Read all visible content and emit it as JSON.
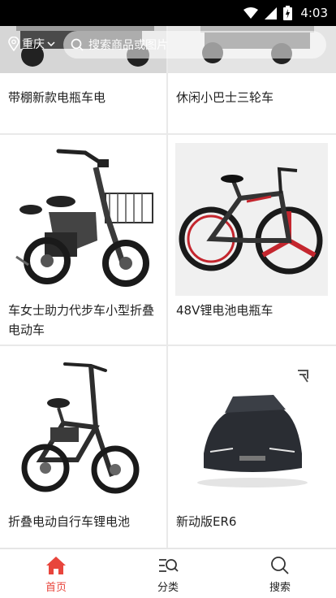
{
  "status_bar": {
    "time": "4:03"
  },
  "header": {
    "location": "重庆",
    "search_placeholder": "搜索商品或图片"
  },
  "products": [
    {
      "name": "带棚新款电瓶车电"
    },
    {
      "name": "休闲小巴士三轮车"
    },
    {
      "name": "车女士助力代步车小型折叠电动车"
    },
    {
      "name": "48V锂电池电瓶车"
    },
    {
      "name": "折叠电动自行车锂电池"
    },
    {
      "name": "新动版ER6"
    }
  ],
  "tab_bar": {
    "items": [
      {
        "label": "首页",
        "icon": "home-icon",
        "active": true
      },
      {
        "label": "分类",
        "icon": "category-icon",
        "active": false
      },
      {
        "label": "搜索",
        "icon": "search-icon",
        "active": false
      }
    ]
  },
  "colors": {
    "accent": "#e8453c",
    "status_bar": "#000000"
  }
}
